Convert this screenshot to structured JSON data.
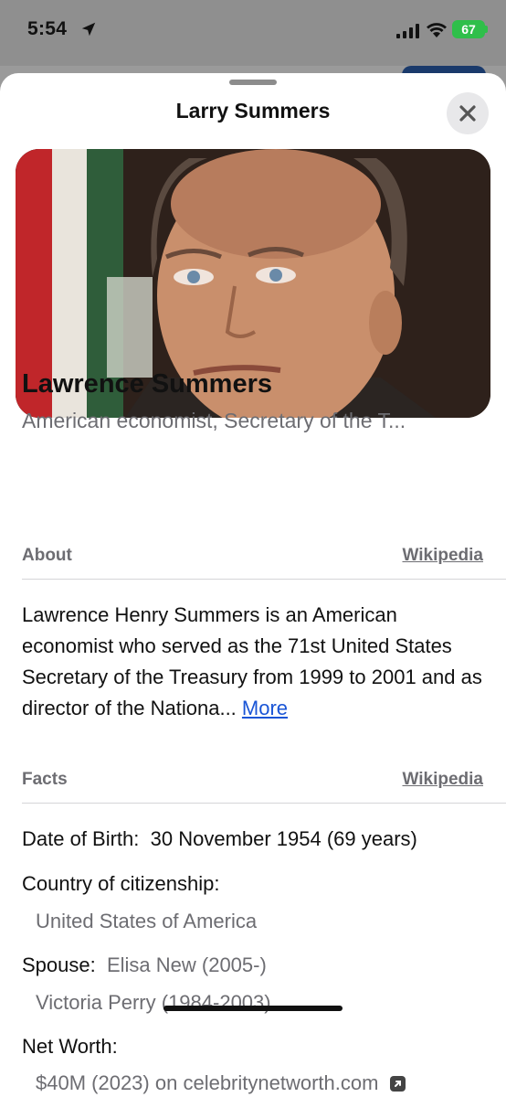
{
  "status_bar": {
    "time": "5:54",
    "battery": "67"
  },
  "sheet": {
    "title": "Larry Summers"
  },
  "person": {
    "name": "Lawrence Summers",
    "description": "American economist, Secretary of the T..."
  },
  "about": {
    "heading": "About",
    "source_link": "Wikipedia",
    "text": "Lawrence Henry Summers is an American economist who served as the 71st United States Secretary of the Treasury from 1999 to 2001 and as director of the Nationa...",
    "more_link": "More"
  },
  "facts": {
    "heading": "Facts",
    "source_link": "Wikipedia",
    "dob_label": "Date of Birth:",
    "dob_value": "30 November 1954 (69 years)",
    "citizenship_label": "Country of citizenship:",
    "citizenship_value": "United States of America",
    "spouse_label": "Spouse:",
    "spouses": [
      "Elisa New (2005-)",
      "Victoria Perry (1984-2003)"
    ],
    "net_worth_label": "Net Worth:",
    "net_worth_value": "$40M (2023)",
    "net_worth_source": "on celebritynetworth.com"
  },
  "colors": {
    "link_blue": "#1a55d6",
    "secondary_gray": "#6d6d72",
    "battery_green": "#2fbf4a"
  }
}
